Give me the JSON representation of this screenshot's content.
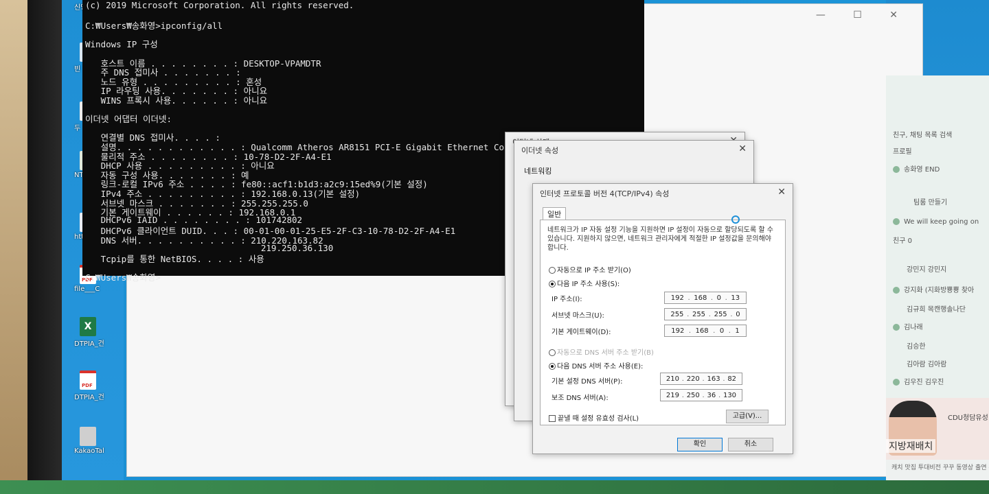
{
  "desktop": {
    "icons": [
      {
        "label": "빈",
        "kind": "generic"
      },
      {
        "label": "두",
        "kind": "generic"
      },
      {
        "label": "NTS_",
        "kind": "generic"
      },
      {
        "label": "http_",
        "kind": "generic"
      },
      {
        "label": "file___C",
        "kind": "pdf"
      },
      {
        "label": "DTPIA_건",
        "kind": "xls"
      },
      {
        "label": "DTPIA_건",
        "kind": "pdf"
      },
      {
        "label": "KakaoTal",
        "kind": "generic"
      }
    ],
    "top_label": "신영"
  },
  "cmd": {
    "lines": [
      "(c) 2019 Microsoft Corporation. All rights reserved.",
      "",
      "C:₩Users₩송화영>ipconfig/all",
      "",
      "Windows IP 구성",
      "",
      "   호스트 이름 . . . . . . . . : DESKTOP-VPAMDTR",
      "   주 DNS 접미사 . . . . . . . :",
      "   노드 유형 . . . . . . . . . : 혼성",
      "   IP 라우팅 사용. . . . . . . : 아니요",
      "   WINS 프록시 사용. . . . . . : 아니요",
      "",
      "이더넷 어댑터 이더넷:",
      "",
      "   연결별 DNS 접미사. . . . :",
      "   설명. . . . . . . . . . . . : Qualcomm Atheros AR8151 PCI-E Gigabit Ethernet Controller",
      "   물리적 주소 . . . . . . . . : 10-78-D2-2F-A4-E1",
      "   DHCP 사용 . . . . . . . . . : 아니요",
      "   자동 구성 사용. . . . . . . : 예",
      "   링크-로컬 IPv6 주소 . . . . : fe80::acf1:b1d3:a2c9:15ed%9(기본 설정)",
      "   IPv4 주소 . . . . . . . . . : 192.168.0.13(기본 설정)",
      "   서브넷 마스크 . . . . . . . : 255.255.255.0",
      "   기본 게이트웨이 . . . . . . : 192.168.0.1",
      "   DHCPv6 IAID . . . . . . . . : 101742802",
      "   DHCPv6 클라이언트 DUID. . . : 00-01-00-01-25-E5-2F-C3-10-78-D2-2F-A4-E1",
      "   DNS 서버. . . . . . . . . . : 210.220.163.82",
      "                                  219.250.36.130",
      "   Tcpip를 통한 NetBIOS. . . . : 사용",
      "",
      "C:₩Users₩송화영>"
    ]
  },
  "dialog_back": {
    "title": "이더넷 상태",
    "close": "✕"
  },
  "dialog_mid": {
    "title": "이더넷 속성",
    "tab": "네트워킹",
    "close": "✕"
  },
  "dialog_ipv4": {
    "title": "인터넷 프로토콜 버전 4(TCP/IPv4) 속성",
    "close": "✕",
    "tab": "일반",
    "description": "네트워크가 IP 자동 설정 기능을 지원하면 IP 설정이 자동으로 할당되도록 할 수 있습니다. 지원하지 않으면, 네트워크 관리자에게 적절한 IP 설정값을 문의해야 합니다.",
    "auto_ip_label": "자동으로 IP 주소 받기(O)",
    "manual_ip_label": "다음 IP 주소 사용(S):",
    "ip_label": "IP 주소(I):",
    "ip": [
      "192",
      "168",
      "0",
      "13"
    ],
    "mask_label": "서브넷 마스크(U):",
    "mask": [
      "255",
      "255",
      "255",
      "0"
    ],
    "gateway_label": "기본 게이트웨이(D):",
    "gateway": [
      "192",
      "168",
      "0",
      "1"
    ],
    "auto_dns_label": "자동으로 DNS 서버 주소 받기(B)",
    "manual_dns_label": "다음 DNS 서버 주소 사용(E):",
    "dns1_label": "기본 설정 DNS 서버(P):",
    "dns1": [
      "210",
      "220",
      "163",
      "82"
    ],
    "dns2_label": "보조 DNS 서버(A):",
    "dns2": [
      "219",
      "250",
      "36",
      "130"
    ],
    "validate_label": "끝낼 때 설정 유효성 검사(L)",
    "advanced_label": "고급(V)...",
    "ok_label": "확인",
    "cancel_label": "취소"
  },
  "kakao": {
    "rows": [
      "친구, 채팅 목록 검색",
      "프로필",
      "송화영  END",
      "팀룸 만들기",
      "We will keep going on",
      "친구 0",
      "강민지  강민지",
      "강지화  (지화방뿅뿅 찾아",
      "김규희  목캔행솔나단",
      "김나래",
      "김승한",
      "김아람  김아람",
      "김우진  김우진"
    ],
    "ad_title": "CDU청담유성",
    "ad_sub": "지방재배치",
    "bottom": "캐치 맛집 투대비전 꾸꾸 동영상 출연 수 캐시워 쿠"
  },
  "window_buttons": "—  ☐  ✕"
}
